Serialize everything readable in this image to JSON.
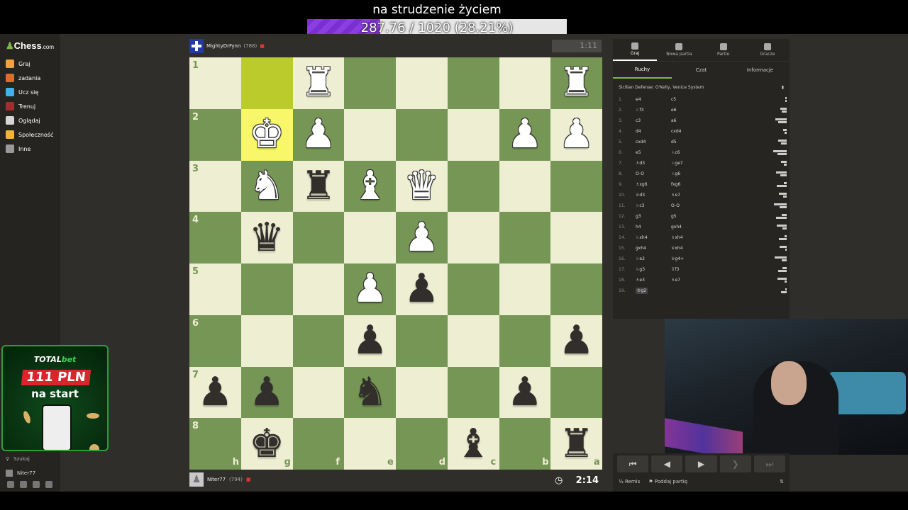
{
  "stream": {
    "goal_title": "na strudzenie życiem",
    "goal_text": "287.76 / 1020 (28.21%)",
    "goal_fraction": 0.2821
  },
  "sidebar": {
    "logo": "Chess",
    "logo_suffix": ".com",
    "items": [
      {
        "label": "Graj",
        "icon": "pawn-icon",
        "color": "#f3a13b"
      },
      {
        "label": "zadania",
        "icon": "puzzle-icon",
        "color": "#e36a2e"
      },
      {
        "label": "Ucz się",
        "icon": "learn-icon",
        "color": "#3db3e8"
      },
      {
        "label": "Trenuj",
        "icon": "target-icon",
        "color": "#a03030"
      },
      {
        "label": "Oglądaj",
        "icon": "watch-icon",
        "color": "#d6d6d6"
      },
      {
        "label": "Społeczność",
        "icon": "community-icon",
        "color": "#f3b33b"
      },
      {
        "label": "Inne",
        "icon": "more-icon",
        "color": "#999999"
      }
    ],
    "search_label": "Szukaj",
    "username": "Niter77"
  },
  "ad": {
    "brand_a": "TOTAL",
    "brand_b": "bet",
    "amount": "111 PLN",
    "subtitle": "na start"
  },
  "top_player": {
    "name": "MightyDrFynn",
    "rating": "(788)"
  },
  "top_clock": "1:11",
  "bottom_player": {
    "name": "Niter77",
    "rating": "(794)"
  },
  "bottom_clock": "2:14",
  "board": {
    "ranks": [
      "1",
      "2",
      "3",
      "4",
      "5",
      "6",
      "7",
      "8"
    ],
    "files": [
      "h",
      "g",
      "f",
      "e",
      "d",
      "c",
      "b",
      "a"
    ],
    "pieces": [
      {
        "sq": "f1",
        "glyph": "♜",
        "color": "w"
      },
      {
        "sq": "a1",
        "glyph": "♜",
        "color": "w"
      },
      {
        "sq": "g2",
        "glyph": "♚",
        "color": "w"
      },
      {
        "sq": "f2",
        "glyph": "♟",
        "color": "w"
      },
      {
        "sq": "b2",
        "glyph": "♟",
        "color": "w"
      },
      {
        "sq": "a2",
        "glyph": "♟",
        "color": "w"
      },
      {
        "sq": "g3",
        "glyph": "♞",
        "color": "w"
      },
      {
        "sq": "f3",
        "glyph": "♜",
        "color": "b"
      },
      {
        "sq": "e3",
        "glyph": "♝",
        "color": "w"
      },
      {
        "sq": "d3",
        "glyph": "♛",
        "color": "w"
      },
      {
        "sq": "g4",
        "glyph": "♛",
        "color": "b"
      },
      {
        "sq": "d4",
        "glyph": "♟",
        "color": "w"
      },
      {
        "sq": "e5",
        "glyph": "♟",
        "color": "w"
      },
      {
        "sq": "d5",
        "glyph": "♟",
        "color": "b"
      },
      {
        "sq": "e6",
        "glyph": "♟",
        "color": "b"
      },
      {
        "sq": "a6",
        "glyph": "♟",
        "color": "b"
      },
      {
        "sq": "h7",
        "glyph": "♟",
        "color": "b"
      },
      {
        "sq": "g7",
        "glyph": "♟",
        "color": "b"
      },
      {
        "sq": "e7",
        "glyph": "♞",
        "color": "b"
      },
      {
        "sq": "b7",
        "glyph": "♟",
        "color": "b"
      },
      {
        "sq": "g8",
        "glyph": "♚",
        "color": "b"
      },
      {
        "sq": "c8",
        "glyph": "♝",
        "color": "b"
      },
      {
        "sq": "a8",
        "glyph": "♜",
        "color": "b"
      }
    ],
    "highlight_green": "g1",
    "highlight_yellow": "g2"
  },
  "panel": {
    "top_tabs": [
      "Graj",
      "Nowa partia",
      "Partie",
      "Gracze"
    ],
    "tabs": [
      "Ruchy",
      "Czat",
      "Informacje"
    ],
    "opening": "Sicilian Defense: O'Kelly, Venice System",
    "moves": [
      [
        "1.",
        "e4",
        "c5"
      ],
      [
        "2.",
        "♘f3",
        "e6"
      ],
      [
        "3.",
        "c3",
        "a6"
      ],
      [
        "4.",
        "d4",
        "cxd4"
      ],
      [
        "5.",
        "cxd4",
        "d5"
      ],
      [
        "6.",
        "e5",
        "♘c6"
      ],
      [
        "7.",
        "♗d3",
        "♘ge7"
      ],
      [
        "8.",
        "O-O",
        "♘g6"
      ],
      [
        "9.",
        "♗xg6",
        "fxg6"
      ],
      [
        "10.",
        "♕d3",
        "♗e7"
      ],
      [
        "11.",
        "♘c3",
        "O-O"
      ],
      [
        "12.",
        "g3",
        "g5"
      ],
      [
        "13.",
        "h4",
        "gxh4"
      ],
      [
        "14.",
        "♘xh4",
        "♗xh4"
      ],
      [
        "15.",
        "gxh4",
        "♕xh4"
      ],
      [
        "16.",
        "♘e2",
        "♕g4+"
      ],
      [
        "17.",
        "♘g3",
        "♖f3"
      ],
      [
        "18.",
        "♗e3",
        "♗e7"
      ],
      [
        "19.",
        "♔g2",
        ""
      ]
    ],
    "actions": {
      "draw": "½ Remis",
      "resign": "Poddaj partię"
    }
  }
}
